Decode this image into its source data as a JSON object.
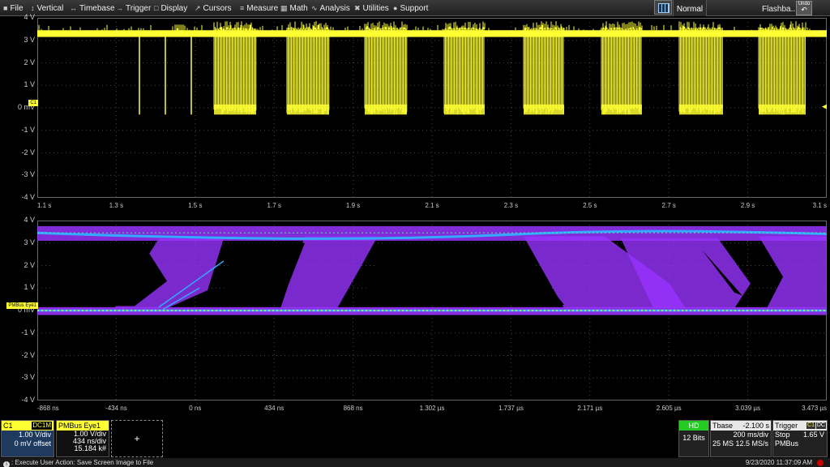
{
  "menu": [
    {
      "icon": "■",
      "label": "File",
      "name": "menu-file"
    },
    {
      "icon": "↕",
      "label": "Vertical",
      "name": "menu-vertical"
    },
    {
      "icon": "↔",
      "label": "Timebase",
      "name": "menu-timebase"
    },
    {
      "icon": "→",
      "label": "Trigger",
      "name": "menu-trigger"
    },
    {
      "icon": "□",
      "label": "Display",
      "name": "menu-display"
    },
    {
      "icon": "↗",
      "label": "Cursors",
      "name": "menu-cursors"
    },
    {
      "icon": "≡",
      "label": "Measure",
      "name": "menu-measure"
    },
    {
      "icon": "▦",
      "label": "Math",
      "name": "menu-math"
    },
    {
      "icon": "∿",
      "label": "Analysis",
      "name": "menu-analysis"
    },
    {
      "icon": "✖",
      "label": "Utilities",
      "name": "menu-utilities"
    },
    {
      "icon": "●",
      "label": "Support",
      "name": "menu-support"
    }
  ],
  "toolbar": {
    "mode": "Normal",
    "flashback": "Flashba...",
    "undo": "Undo"
  },
  "colors": {
    "trace": "#ffff33",
    "eye": "#9933ff",
    "eye_line": "#33aaff",
    "grid": "#444444"
  },
  "grid_top": {
    "ylabels": [
      "4 V",
      "3 V",
      "2 V",
      "1 V",
      "0 mV",
      "-1 V",
      "-2 V",
      "-3 V",
      "-4 V"
    ],
    "xlabels": [
      "1.1 s",
      "1.3 s",
      "1.5 s",
      "1.7 s",
      "1.9 s",
      "2.1 s",
      "2.3 s",
      "2.5 s",
      "2.7 s",
      "2.9 s",
      "3.1 s"
    ],
    "marker": "C1"
  },
  "grid_bottom": {
    "ylabels": [
      "4 V",
      "3 V",
      "2 V",
      "1 V",
      "0 mV",
      "-1 V",
      "-2 V",
      "-3 V",
      "-4 V"
    ],
    "xlabels": [
      "-868 ns",
      "-434 ns",
      "0 ns",
      "434 ns",
      "868 ns",
      "1.302 µs",
      "1.737 µs",
      "2.171 µs",
      "2.605 µs",
      "3.039 µs",
      "3.473 µs"
    ],
    "marker": "PMBus Eye1"
  },
  "c1": {
    "name": "C1",
    "coupling": "DC1M",
    "vdiv": "1.00 V/div",
    "offset": "0 mV offset"
  },
  "eye": {
    "name": "PMBus Eye1",
    "vdiv": "1.00 V/div",
    "tdiv": "434 ns/div",
    "count": "15.184 k#"
  },
  "add": {
    "symbol": "+"
  },
  "hd": {
    "badge": "HD",
    "bits": "12 Bits"
  },
  "tbase": {
    "label": "Tbase",
    "delay": "-2.100 s",
    "tdiv": "200 ms/div",
    "samples": "25 MS",
    "rate": "12.5 MS/s"
  },
  "trigger": {
    "label": "Trigger",
    "source": "C1",
    "coupling": "DC",
    "mode": "Stop",
    "level": "1.65 V",
    "type": "PMBus"
  },
  "status": {
    "message": ": Execute User Action: Save Screen Image to File",
    "timestamp": "9/23/2020 11:37:09 AM"
  }
}
